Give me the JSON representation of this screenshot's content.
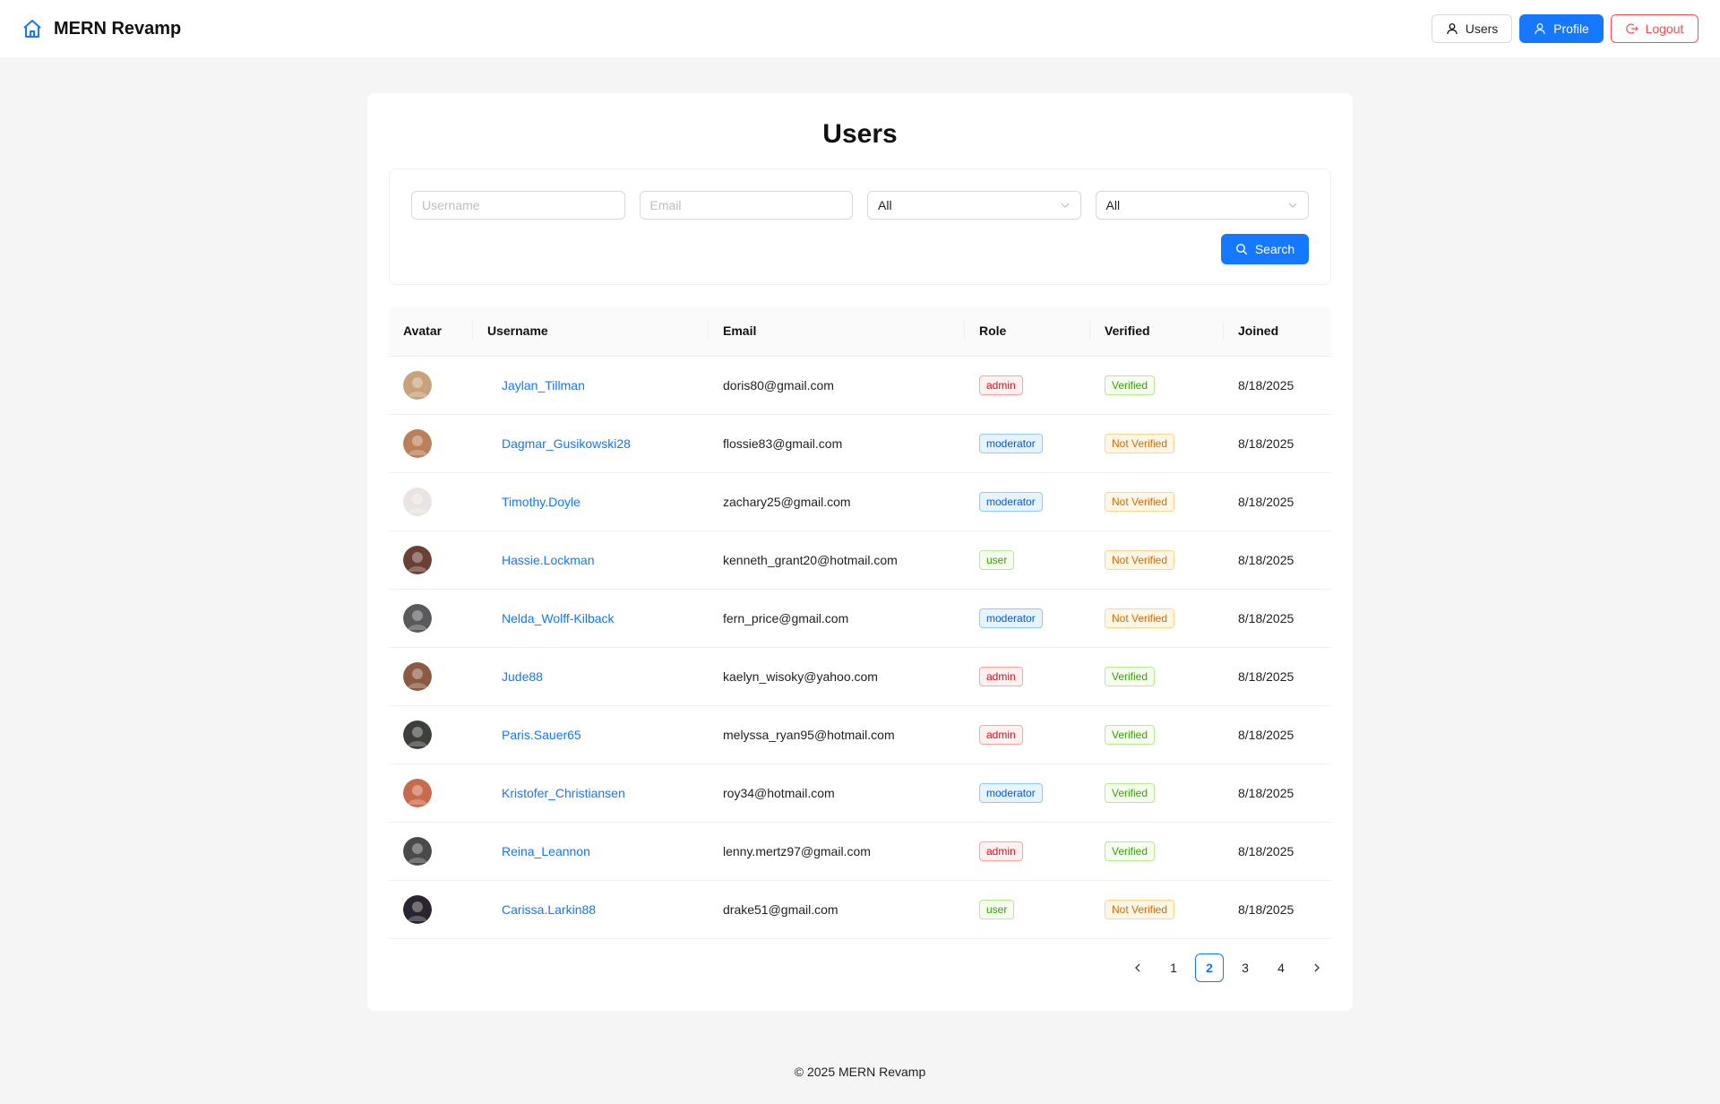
{
  "header": {
    "brand_title": "MERN Revamp",
    "brand_icon": "home-icon",
    "nav": {
      "users_label": "Users",
      "profile_label": "Profile",
      "logout_label": "Logout"
    }
  },
  "page": {
    "title": "Users"
  },
  "filters": {
    "username_placeholder": "Username",
    "email_placeholder": "Email",
    "role_select_value": "All",
    "verified_select_value": "All",
    "search_label": "Search"
  },
  "table": {
    "columns": [
      "Avatar",
      "Username",
      "Email",
      "Role",
      "Verified",
      "Joined"
    ],
    "rows": [
      {
        "username": "Jaylan_Tillman",
        "email": "doris80@gmail.com",
        "role": "admin",
        "verified": "Verified",
        "joined": "8/18/2025",
        "avatar_color": "#c8a27a"
      },
      {
        "username": "Dagmar_Gusikowski28",
        "email": "flossie83@gmail.com",
        "role": "moderator",
        "verified": "Not Verified",
        "joined": "8/18/2025",
        "avatar_color": "#b9805a"
      },
      {
        "username": "Timothy.Doyle",
        "email": "zachary25@gmail.com",
        "role": "moderator",
        "verified": "Not Verified",
        "joined": "8/18/2025",
        "avatar_color": "#e9e4e1"
      },
      {
        "username": "Hassie.Lockman",
        "email": "kenneth_grant20@hotmail.com",
        "role": "user",
        "verified": "Not Verified",
        "joined": "8/18/2025",
        "avatar_color": "#6b4034"
      },
      {
        "username": "Nelda_Wolff-Kilback",
        "email": "fern_price@gmail.com",
        "role": "moderator",
        "verified": "Not Verified",
        "joined": "8/18/2025",
        "avatar_color": "#5a5a5c"
      },
      {
        "username": "Jude88",
        "email": "kaelyn_wisoky@yahoo.com",
        "role": "admin",
        "verified": "Verified",
        "joined": "8/18/2025",
        "avatar_color": "#8a5a42"
      },
      {
        "username": "Paris.Sauer65",
        "email": "melyssa_ryan95@hotmail.com",
        "role": "admin",
        "verified": "Verified",
        "joined": "8/18/2025",
        "avatar_color": "#3c3f3a"
      },
      {
        "username": "Kristofer_Christiansen",
        "email": "roy34@hotmail.com",
        "role": "moderator",
        "verified": "Verified",
        "joined": "8/18/2025",
        "avatar_color": "#c86a4e"
      },
      {
        "username": "Reina_Leannon",
        "email": "lenny.mertz97@gmail.com",
        "role": "admin",
        "verified": "Verified",
        "joined": "8/18/2025",
        "avatar_color": "#4a4a4a"
      },
      {
        "username": "Carissa.Larkin88",
        "email": "drake51@gmail.com",
        "role": "user",
        "verified": "Not Verified",
        "joined": "8/18/2025",
        "avatar_color": "#2a2430"
      }
    ]
  },
  "pagination": {
    "pages": [
      "1",
      "2",
      "3",
      "4"
    ],
    "current": "2"
  },
  "footer": {
    "text": "© 2025 MERN Revamp"
  },
  "colors": {
    "primary": "#1677ff",
    "danger": "#ff4d4f",
    "background": "#f5f5f5"
  }
}
